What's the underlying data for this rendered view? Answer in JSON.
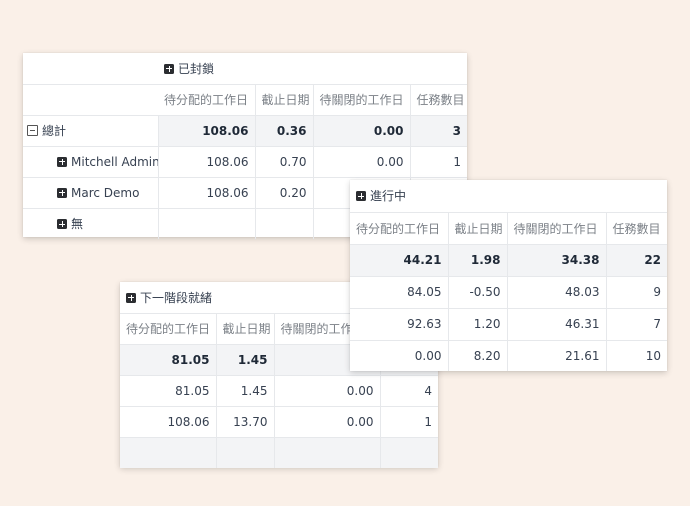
{
  "columns": [
    "待分配的工作日",
    "截止日期",
    "待關閉的工作日",
    "任務數目"
  ],
  "blocked": {
    "header": "已封鎖",
    "total_label": "總計",
    "rows": [
      {
        "label": "總計",
        "v": [
          "108.06",
          "0.36",
          "0.00",
          "3"
        ]
      },
      {
        "label": "Mitchell Admin",
        "v": [
          "108.06",
          "0.70",
          "0.00",
          "1"
        ]
      },
      {
        "label": "Marc Demo",
        "v": [
          "108.06",
          "0.20",
          "",
          ""
        ]
      },
      {
        "label": "無",
        "v": [
          "",
          "",
          "",
          ""
        ]
      }
    ]
  },
  "ready": {
    "header": "下一階段就緒",
    "col3_partial": "待關閉的工作",
    "rows": [
      {
        "v": [
          "81.05",
          "1.45",
          "",
          ""
        ]
      },
      {
        "v": [
          "81.05",
          "1.45",
          "0.00",
          "4"
        ]
      },
      {
        "v": [
          "108.06",
          "13.70",
          "0.00",
          "1"
        ]
      },
      {
        "v": [
          "",
          "",
          "",
          ""
        ]
      }
    ]
  },
  "progress": {
    "header": "進行中",
    "rows": [
      {
        "v": [
          "44.21",
          "1.98",
          "34.38",
          "22"
        ]
      },
      {
        "v": [
          "84.05",
          "-0.50",
          "48.03",
          "9"
        ]
      },
      {
        "v": [
          "92.63",
          "1.20",
          "46.31",
          "7"
        ]
      },
      {
        "v": [
          "0.00",
          "8.20",
          "21.61",
          "10"
        ]
      }
    ]
  }
}
